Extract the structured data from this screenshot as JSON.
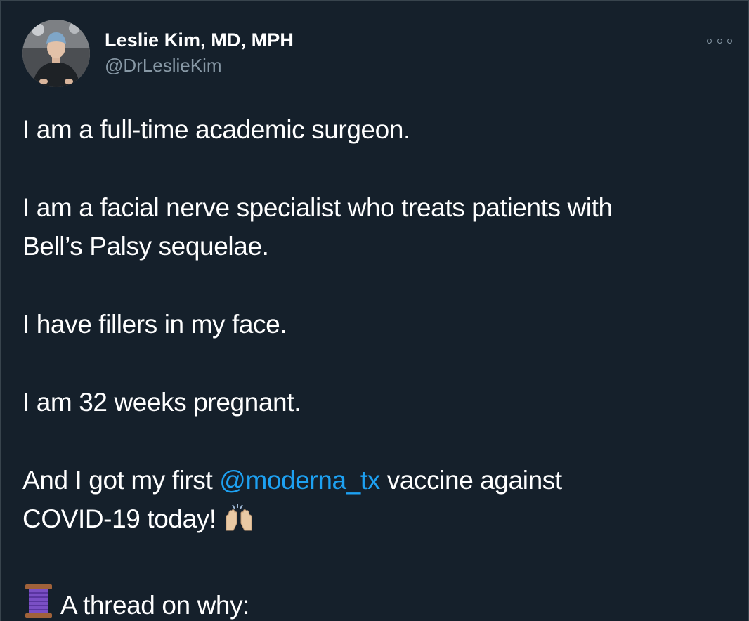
{
  "author": {
    "display_name": "Leslie Kim, MD, MPH",
    "handle": "@DrLeslieKim"
  },
  "menu": {
    "icon": "more-horizontal-icon"
  },
  "tweet": {
    "line1": "I am a full-time academic surgeon.",
    "line2a": "I am a facial nerve specialist who treats patients with",
    "line2b": "Bell’s Palsy sequelae.",
    "line3": "I have fillers in my face.",
    "line4": "I am 32 weeks pregnant.",
    "line5_pre": "And I got my first ",
    "line5_mention": "@moderna_tx",
    "line5_post": " vaccine against",
    "line6": "COVID-19 today!",
    "line7": "A thread on why:"
  },
  "emojis": {
    "raising_hands": "raising-hands-icon",
    "thread": "spool-of-thread-icon"
  },
  "colors": {
    "background": "#15202b",
    "text": "#ffffff",
    "secondary_text": "#8899a6",
    "link": "#1da1f2"
  }
}
